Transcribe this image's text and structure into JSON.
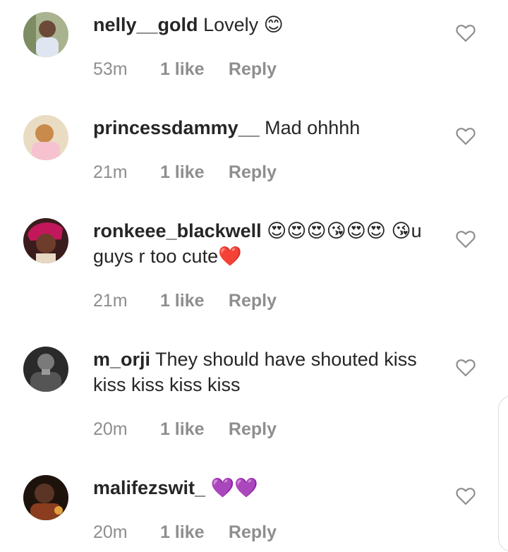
{
  "comments": [
    {
      "username": "nelly__gold",
      "text": "Lovely 😊",
      "time": "53m",
      "likes": "1 like",
      "reply": "Reply"
    },
    {
      "username": "princessdammy__",
      "text": "Mad ohhhh",
      "time": "21m",
      "likes": "1 like",
      "reply": "Reply"
    },
    {
      "username": "ronkeee_blackwell",
      "text": "😍😍😍😘😍😍 😘u guys r too cute❤️",
      "time": "21m",
      "likes": "1 like",
      "reply": "Reply"
    },
    {
      "username": "m_orji",
      "text": "They should have shouted kiss kiss kiss kiss kiss",
      "time": "20m",
      "likes": "1 like",
      "reply": "Reply"
    },
    {
      "username": "malifezswit_",
      "text": "💜💜",
      "time": "20m",
      "likes": "1 like",
      "reply": "Reply"
    }
  ],
  "icons": {
    "like": "heart-outline-icon"
  },
  "colors": {
    "text": "#262626",
    "meta": "#8e8e8e"
  }
}
